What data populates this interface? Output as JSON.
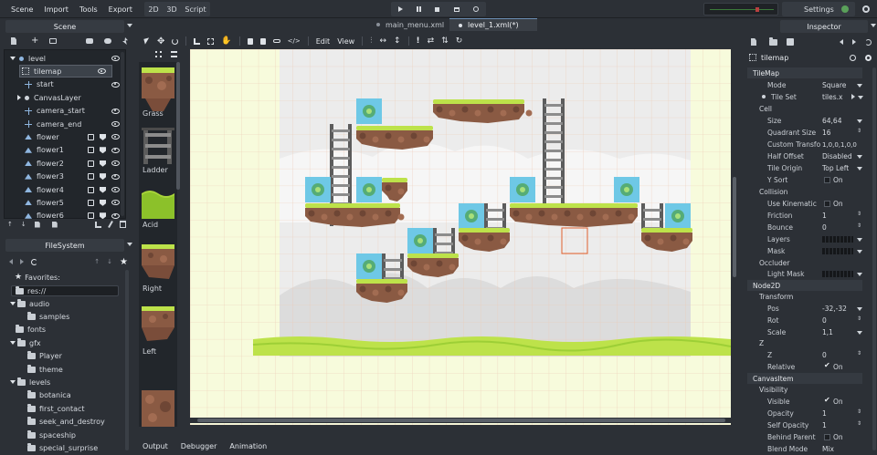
{
  "colors": {
    "bg": "#2c3036",
    "panel_dark": "#22262b",
    "accent": "#4b8fd6",
    "canvas_bg": "#f7fbdc",
    "grid": "#e9c6b0",
    "grass": "#bde24a",
    "rock": "#8a5a43",
    "ladder": "#5a5a5a",
    "water": "#6ec8e6"
  },
  "menu": {
    "items": [
      "Scene",
      "Import",
      "Tools",
      "Export"
    ],
    "modes": [
      "2D",
      "3D",
      "Script"
    ],
    "settings": "Settings"
  },
  "playbar": {
    "icons": [
      "play-icon",
      "pause-icon",
      "stop-icon",
      "play-scene-icon",
      "debug-icon"
    ]
  },
  "tabs": {
    "items": [
      "main_menu.xml",
      "level_1.xml(*)"
    ]
  },
  "scene": {
    "title": "Scene",
    "nodes": [
      {
        "label": "level",
        "indent": 0
      },
      {
        "label": "tilemap",
        "indent": 1
      },
      {
        "label": "start",
        "indent": 1
      },
      {
        "label": "CanvasLayer",
        "indent": 1
      },
      {
        "label": "camera_start",
        "indent": 1
      },
      {
        "label": "camera_end",
        "indent": 1
      },
      {
        "label": "flower",
        "indent": 1
      },
      {
        "label": "flower1",
        "indent": 1
      },
      {
        "label": "flower2",
        "indent": 1
      },
      {
        "label": "flower3",
        "indent": 1
      },
      {
        "label": "flower4",
        "indent": 1
      },
      {
        "label": "flower5",
        "indent": 1
      },
      {
        "label": "flower6",
        "indent": 1
      }
    ]
  },
  "filesystem": {
    "title": "FileSystem",
    "favorites": "Favorites:",
    "path": "res://",
    "items": [
      {
        "label": "audio",
        "indent": 1,
        "kind": "folder"
      },
      {
        "label": "samples",
        "indent": 2,
        "kind": "folder"
      },
      {
        "label": "fonts",
        "indent": 1,
        "kind": "folder"
      },
      {
        "label": "gfx",
        "indent": 1,
        "kind": "folder"
      },
      {
        "label": "Player",
        "indent": 2,
        "kind": "folder"
      },
      {
        "label": "theme",
        "indent": 2,
        "kind": "folder"
      },
      {
        "label": "levels",
        "indent": 1,
        "kind": "folder"
      },
      {
        "label": "botanica",
        "indent": 2,
        "kind": "folder"
      },
      {
        "label": "first_contact",
        "indent": 2,
        "kind": "folder"
      },
      {
        "label": "seek_and_destroy",
        "indent": 2,
        "kind": "folder"
      },
      {
        "label": "spaceship",
        "indent": 2,
        "kind": "folder"
      },
      {
        "label": "special_surprise",
        "indent": 2,
        "kind": "folder"
      }
    ]
  },
  "toolbar": {
    "edit": "Edit",
    "view": "View"
  },
  "tiles": {
    "items": [
      "Grass",
      "Ladder",
      "Acid",
      "Right",
      "Left"
    ]
  },
  "bottom": {
    "tabs": [
      "Output",
      "Debugger",
      "Animation"
    ]
  },
  "inspector": {
    "title": "Inspector",
    "node_name": "tilemap",
    "sections": {
      "tilemap": "TileMap",
      "node2d": "Node2D",
      "canvasitem": "CanvasItem"
    },
    "props": {
      "mode": {
        "k": "Mode",
        "v": "Square"
      },
      "tileset": {
        "k": "Tile Set",
        "v": "tiles.x"
      },
      "cell": "Cell",
      "size": {
        "k": "Size",
        "v": "64,64"
      },
      "quadrant": {
        "k": "Quadrant Size",
        "v": "16"
      },
      "custom": {
        "k": "Custom Transfo",
        "v": "1,0,0,1,0,0"
      },
      "halfoffset": {
        "k": "Half Offset",
        "v": "Disabled"
      },
      "origin": {
        "k": "Tile Origin",
        "v": "Top Left"
      },
      "ysort": {
        "k": "Y Sort",
        "v": "On"
      },
      "collision": "Collision",
      "kinematic": {
        "k": "Use Kinematic",
        "v": "On"
      },
      "friction": {
        "k": "Friction",
        "v": "1"
      },
      "bounce": {
        "k": "Bounce",
        "v": "0"
      },
      "layers": {
        "k": "Layers",
        "v": ""
      },
      "mask": {
        "k": "Mask",
        "v": ""
      },
      "occluder": "Occluder",
      "lightmask": {
        "k": "Light Mask",
        "v": ""
      },
      "transform": "Transform",
      "pos": {
        "k": "Pos",
        "v": "-32,-32"
      },
      "rot": {
        "k": "Rot",
        "v": "0"
      },
      "scale": {
        "k": "Scale",
        "v": "1,1"
      },
      "zsec": "Z",
      "z": {
        "k": "Z",
        "v": "0"
      },
      "relative": {
        "k": "Relative",
        "v": "On"
      },
      "visibility": "Visibility",
      "visible": {
        "k": "Visible",
        "v": "On"
      },
      "opacity": {
        "k": "Opacity",
        "v": "1"
      },
      "selfopacity": {
        "k": "Self Opacity",
        "v": "1"
      },
      "behind": {
        "k": "Behind Parent",
        "v": "On"
      },
      "blend": {
        "k": "Blend Mode",
        "v": "Mix"
      }
    }
  }
}
